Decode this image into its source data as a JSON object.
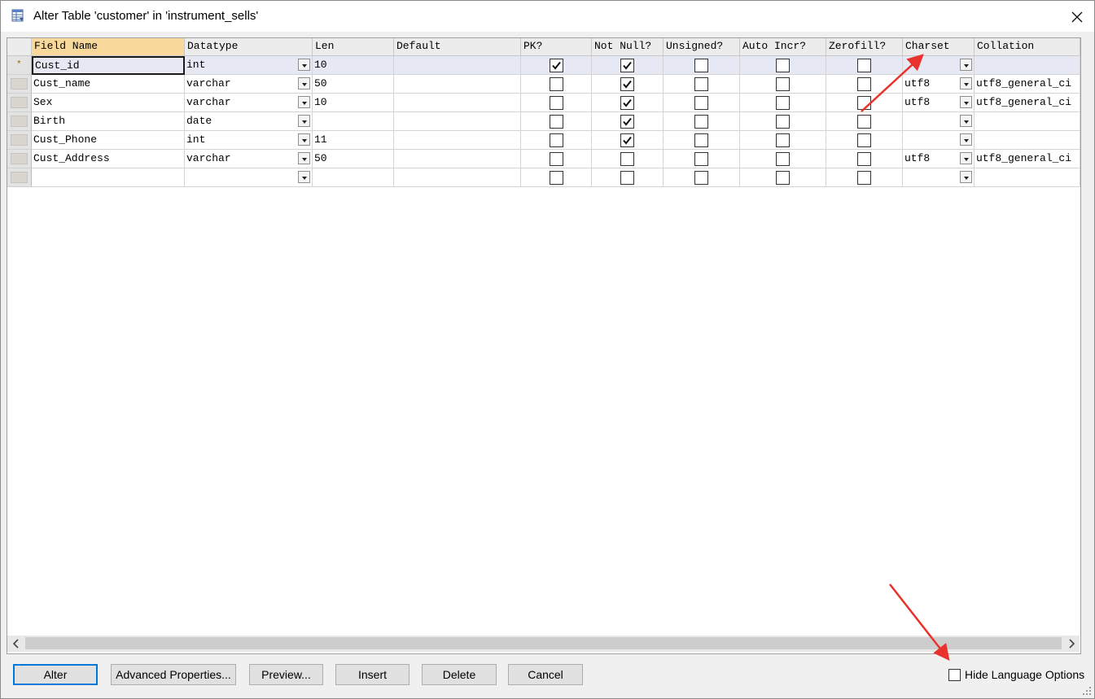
{
  "window": {
    "title": "Alter Table 'customer' in 'instrument_sells'",
    "close_label": "×"
  },
  "columns": [
    "Field Name",
    "Datatype",
    "Len",
    "Default",
    "PK?",
    "Not Null?",
    "Unsigned?",
    "Auto Incr?",
    "Zerofill?",
    "Charset",
    "Collation"
  ],
  "rows": [
    {
      "marker": "*",
      "field": "Cust_id",
      "datatype": "int",
      "len": "10",
      "default": "",
      "pk": true,
      "not_null": true,
      "unsigned": false,
      "auto_incr": false,
      "zerofill": false,
      "charset": "",
      "collation": ""
    },
    {
      "marker": "",
      "field": "Cust_name",
      "datatype": "varchar",
      "len": "50",
      "default": "",
      "pk": false,
      "not_null": true,
      "unsigned": false,
      "auto_incr": false,
      "zerofill": false,
      "charset": "utf8",
      "collation": "utf8_general_ci"
    },
    {
      "marker": "",
      "field": "Sex",
      "datatype": "varchar",
      "len": "10",
      "default": "",
      "pk": false,
      "not_null": true,
      "unsigned": false,
      "auto_incr": false,
      "zerofill": false,
      "charset": "utf8",
      "collation": "utf8_general_ci"
    },
    {
      "marker": "",
      "field": "Birth",
      "datatype": "date",
      "len": "",
      "default": "",
      "pk": false,
      "not_null": true,
      "unsigned": false,
      "auto_incr": false,
      "zerofill": false,
      "charset": "",
      "collation": ""
    },
    {
      "marker": "",
      "field": "Cust_Phone",
      "datatype": "int",
      "len": "11",
      "default": "",
      "pk": false,
      "not_null": true,
      "unsigned": false,
      "auto_incr": false,
      "zerofill": false,
      "charset": "",
      "collation": ""
    },
    {
      "marker": "",
      "field": "Cust_Address",
      "datatype": "varchar",
      "len": "50",
      "default": "",
      "pk": false,
      "not_null": false,
      "unsigned": false,
      "auto_incr": false,
      "zerofill": false,
      "charset": "utf8",
      "collation": "utf8_general_ci"
    },
    {
      "marker": "",
      "field": "",
      "datatype": "",
      "len": "",
      "default": "",
      "pk": false,
      "not_null": false,
      "unsigned": false,
      "auto_incr": false,
      "zerofill": false,
      "charset": "",
      "collation": ""
    }
  ],
  "buttons": {
    "alter": "Alter",
    "advanced": "Advanced Properties...",
    "preview": "Preview...",
    "insert": "Insert",
    "delete": "Delete",
    "cancel": "Cancel"
  },
  "hide_language_options": {
    "label": "Hide Language Options",
    "checked": false
  },
  "colors": {
    "header_active": "#f9d99b",
    "selected_row": "#e6e8f3",
    "annotation_arrow": "#e8322b",
    "default_button_border": "#0078d7"
  },
  "icons": {
    "title": "table-grid-icon",
    "close": "close-icon"
  }
}
